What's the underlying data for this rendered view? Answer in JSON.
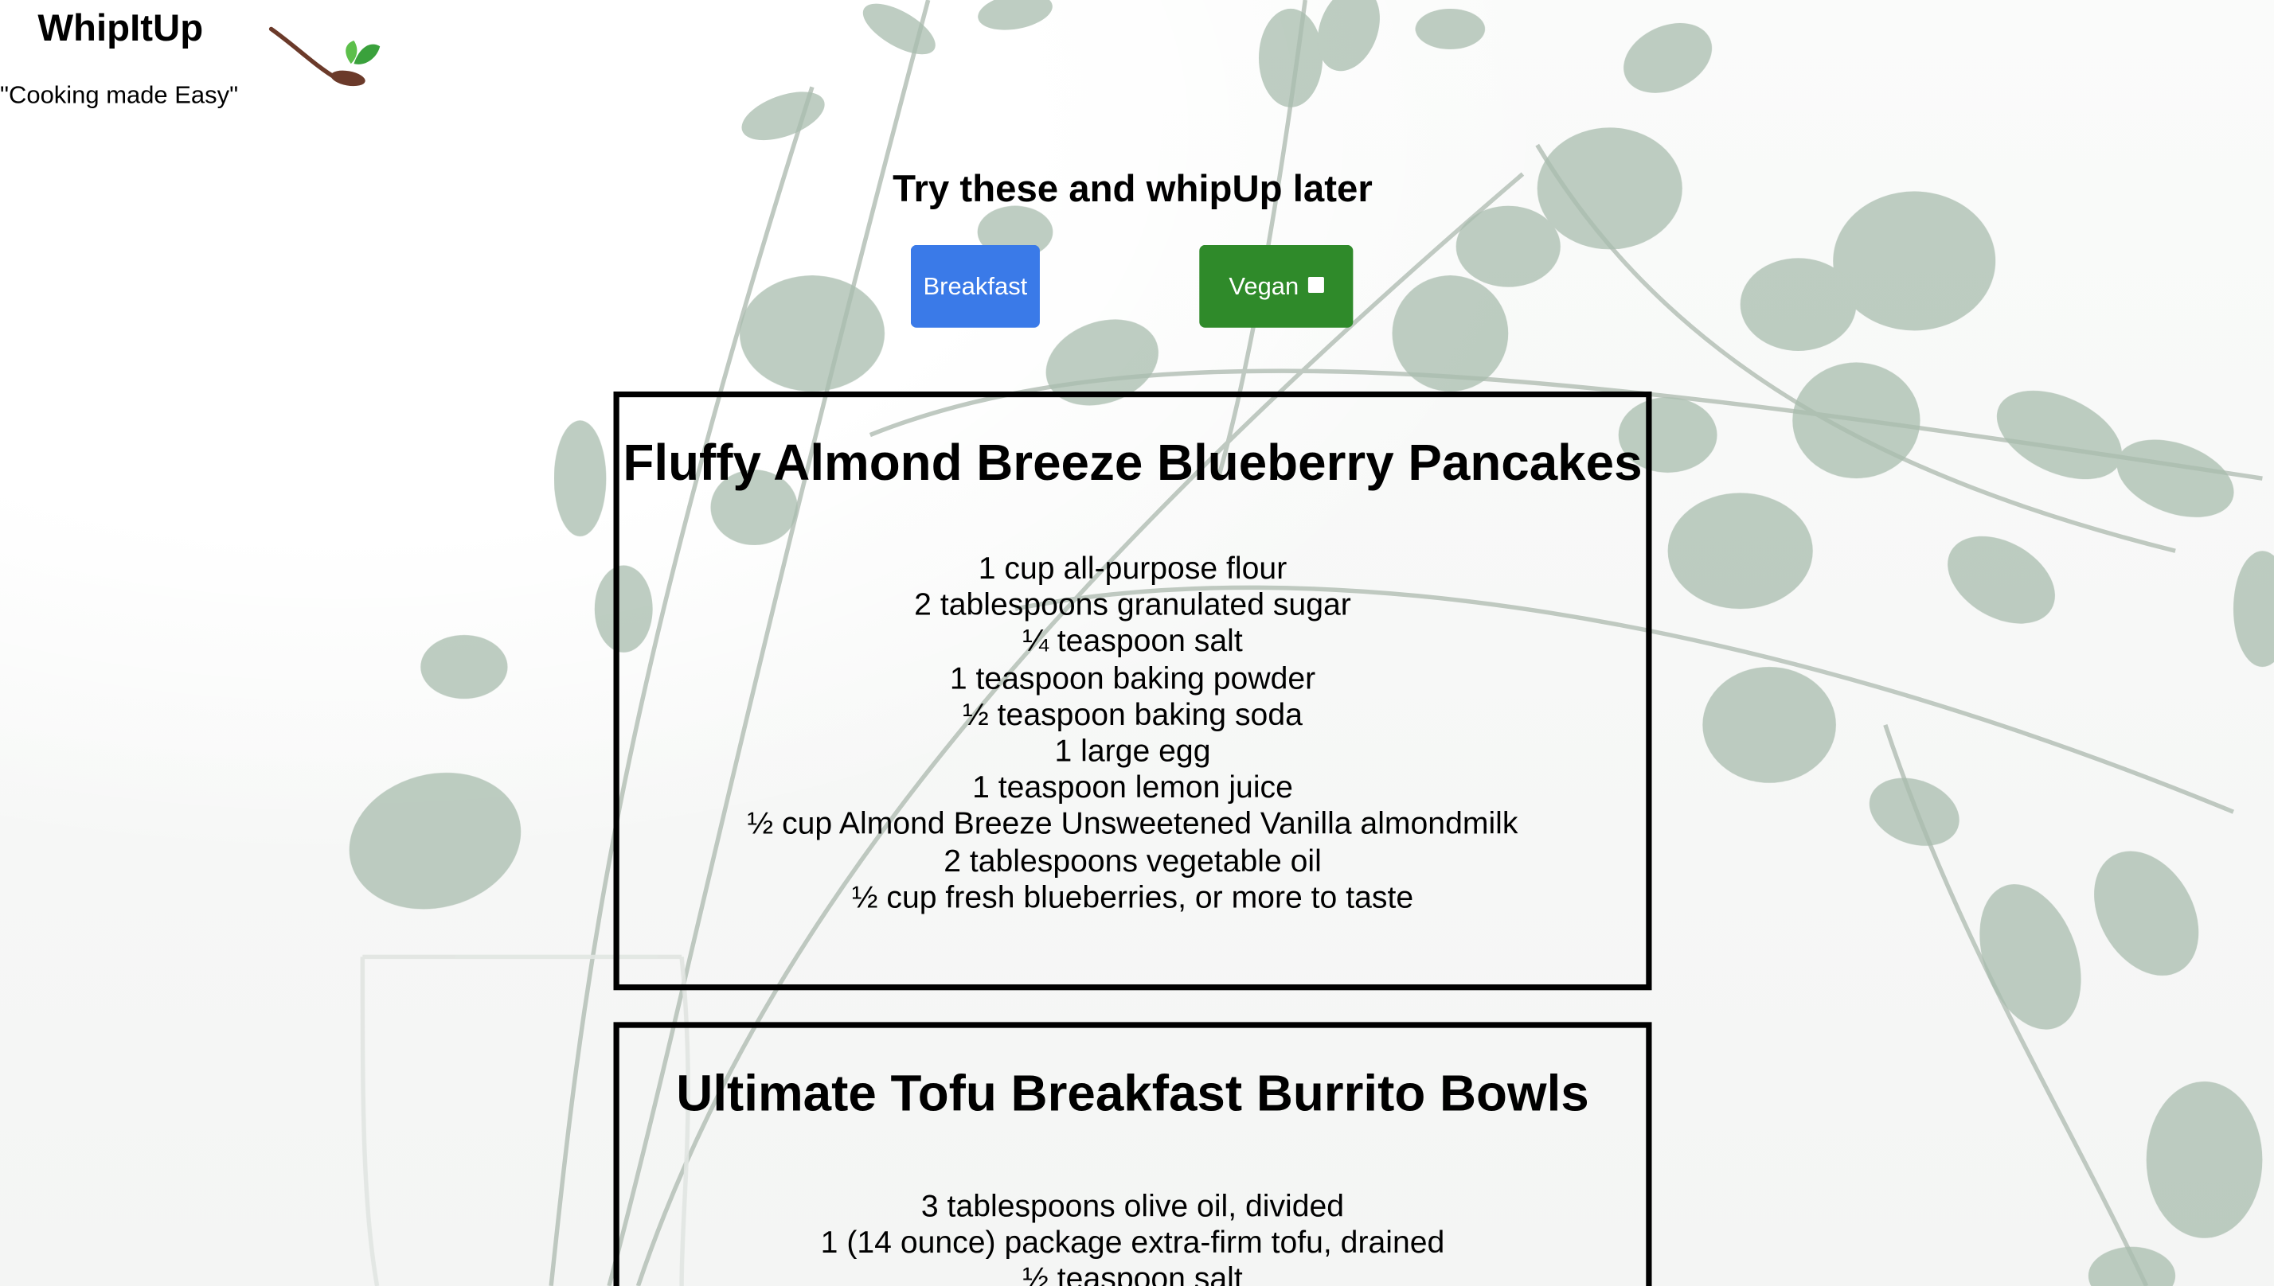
{
  "brand": {
    "name": "WhipItUp",
    "tagline": "\"Cooking made Easy\"",
    "logo_icon": "spoon-leaf-icon"
  },
  "main": {
    "heading": "Try these and whipUp later",
    "filters": [
      {
        "label": "Breakfast",
        "color": "#3a7ae8"
      },
      {
        "label": "Vegan",
        "color": "#2f8a2a",
        "icon": "square-icon"
      }
    ]
  },
  "recipes": [
    {
      "title": "Fluffy Almond Breeze Blueberry Pancakes",
      "ingredients": [
        "1 cup all-purpose flour",
        "2 tablespoons granulated sugar",
        "¼ teaspoon salt",
        "1 teaspoon baking powder",
        "½ teaspoon baking soda",
        "1 large egg",
        "1 teaspoon lemon juice",
        "½ cup Almond Breeze Unsweetened Vanilla almondmilk",
        "2 tablespoons vegetable oil",
        "½ cup fresh blueberries, or more to taste"
      ]
    },
    {
      "title": "Ultimate Tofu Breakfast Burrito Bowls",
      "ingredients": [
        "3 tablespoons olive oil, divided",
        "1 (14 ounce) package extra-firm tofu, drained",
        "½ teaspoon salt"
      ]
    }
  ],
  "colors": {
    "breakfast_button": "#3a7ae8",
    "vegan_button": "#2f8a2a",
    "leaf": "#8fa896",
    "card_border": "#000000"
  }
}
